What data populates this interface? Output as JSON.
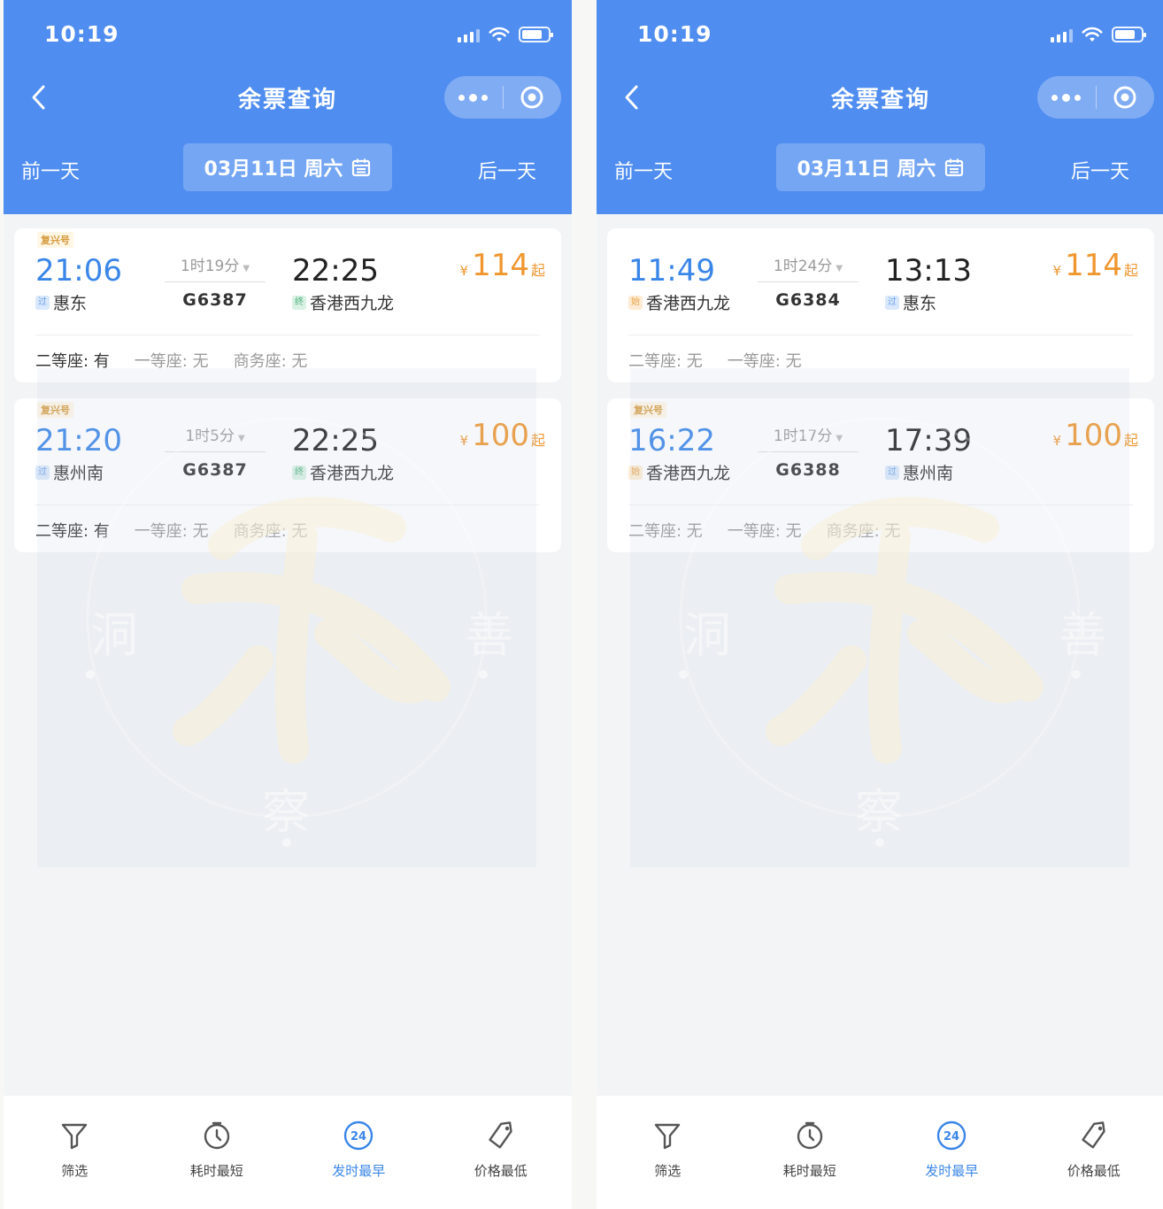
{
  "screens": [
    {
      "status": {
        "time": "10:19"
      },
      "nav": {
        "title": "余票查询"
      },
      "date_bar": {
        "prev": "前一天",
        "date": "03月11日 周六",
        "next": "后一天"
      },
      "trains": [
        {
          "badge": "复兴号",
          "dep_time": "21:06",
          "dep_tag": "过",
          "dep_station": "惠东",
          "duration": "1时19分",
          "train_no": "G6387",
          "arr_time": "22:25",
          "arr_tag": "终",
          "arr_station": "香港西九龙",
          "price_symbol": "¥",
          "price": "114",
          "price_suffix": "起",
          "seats": [
            {
              "label": "二等座: 有",
              "available": true
            },
            {
              "label": "一等座: 无",
              "available": false
            },
            {
              "label": "商务座: 无",
              "available": false
            }
          ]
        },
        {
          "badge": "复兴号",
          "dep_time": "21:20",
          "dep_tag": "过",
          "dep_station": "惠州南",
          "duration": "1时5分",
          "train_no": "G6387",
          "arr_time": "22:25",
          "arr_tag": "终",
          "arr_station": "香港西九龙",
          "price_symbol": "¥",
          "price": "100",
          "price_suffix": "起",
          "seats": [
            {
              "label": "二等座: 有",
              "available": true
            },
            {
              "label": "一等座: 无",
              "available": false
            },
            {
              "label": "商务座: 无",
              "available": false
            }
          ]
        }
      ],
      "tabs": [
        {
          "label": "筛选",
          "icon": "filter-icon"
        },
        {
          "label": "耗时最短",
          "icon": "timer-icon"
        },
        {
          "label": "发时最早",
          "icon": "clock-24-icon",
          "active": true
        },
        {
          "label": "价格最低",
          "icon": "price-tag-icon"
        }
      ]
    },
    {
      "status": {
        "time": "10:19"
      },
      "nav": {
        "title": "余票查询"
      },
      "date_bar": {
        "prev": "前一天",
        "date": "03月11日 周六",
        "next": "后一天"
      },
      "trains": [
        {
          "badge": "",
          "dep_time": "11:49",
          "dep_tag": "始",
          "dep_station": "香港西九龙",
          "duration": "1时24分",
          "train_no": "G6384",
          "arr_time": "13:13",
          "arr_tag": "过",
          "arr_station": "惠东",
          "price_symbol": "¥",
          "price": "114",
          "price_suffix": "起",
          "seats": [
            {
              "label": "二等座: 无",
              "available": false
            },
            {
              "label": "一等座: 无",
              "available": false
            }
          ]
        },
        {
          "badge": "复兴号",
          "dep_time": "16:22",
          "dep_tag": "始",
          "dep_station": "香港西九龙",
          "duration": "1时17分",
          "train_no": "G6388",
          "arr_time": "17:39",
          "arr_tag": "过",
          "arr_station": "惠州南",
          "price_symbol": "¥",
          "price": "100",
          "price_suffix": "起",
          "seats": [
            {
              "label": "二等座: 无",
              "available": false
            },
            {
              "label": "一等座: 无",
              "available": false
            },
            {
              "label": "商务座: 无",
              "available": false
            }
          ]
        }
      ],
      "tabs": [
        {
          "label": "筛选",
          "icon": "filter-icon"
        },
        {
          "label": "耗时最短",
          "icon": "timer-icon"
        },
        {
          "label": "发时最早",
          "icon": "clock-24-icon",
          "active": true
        },
        {
          "label": "价格最低",
          "icon": "price-tag-icon"
        }
      ]
    }
  ],
  "colors": {
    "header": "#4f8df0",
    "accent": "#3a86e8",
    "price": "#f0962f"
  },
  "watermark": {
    "chars": [
      "洞",
      "善",
      "察"
    ]
  }
}
